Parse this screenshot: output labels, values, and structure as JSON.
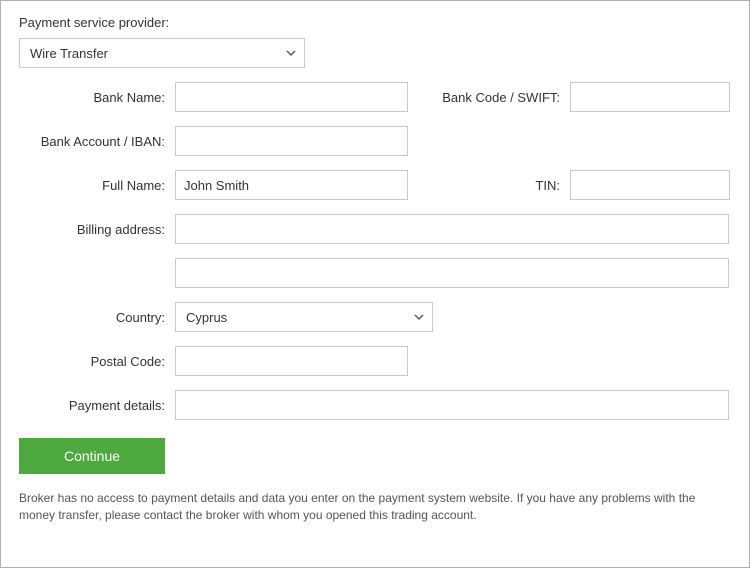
{
  "psp": {
    "label": "Payment service provider:",
    "selected": "Wire Transfer"
  },
  "fields": {
    "bank_name": {
      "label": "Bank Name:",
      "value": ""
    },
    "bank_code": {
      "label": "Bank Code / SWIFT:",
      "value": ""
    },
    "bank_account": {
      "label": "Bank Account / IBAN:",
      "value": ""
    },
    "full_name": {
      "label": "Full Name:",
      "value": "John Smith"
    },
    "tin": {
      "label": "TIN:",
      "value": ""
    },
    "billing_address": {
      "label": "Billing address:",
      "value1": "",
      "value2": ""
    },
    "country": {
      "label": "Country:",
      "selected": "Cyprus"
    },
    "postal_code": {
      "label": "Postal Code:",
      "value": ""
    },
    "payment_details": {
      "label": "Payment details:",
      "value": ""
    }
  },
  "actions": {
    "continue": "Continue"
  },
  "disclaimer": "Broker has no access to payment details and data you enter on the payment system website. If you have any problems with the money transfer, please contact the broker with whom you opened this trading account."
}
